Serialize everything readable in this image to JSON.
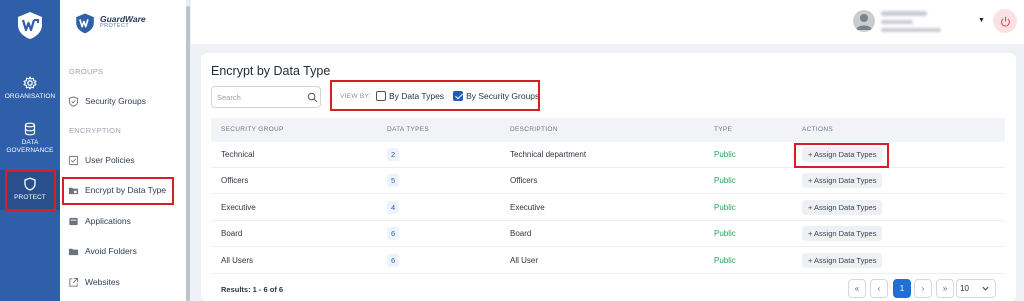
{
  "rail": {
    "items": [
      {
        "label": "ORGANISATION",
        "icon": "gear-icon"
      },
      {
        "label": "DATA\nGOVERNANCE",
        "icon": "database-icon"
      },
      {
        "label": "PROTECT",
        "icon": "shield-icon"
      }
    ]
  },
  "brand": {
    "name": "GuardWare",
    "sub": "PROTECT"
  },
  "sidebar": {
    "sections": [
      {
        "label": "GROUPS",
        "items": [
          {
            "label": "Security Groups",
            "icon": "shield-icon"
          }
        ]
      },
      {
        "label": "ENCRYPTION",
        "items": [
          {
            "label": "User Policies",
            "icon": "checklist-icon"
          },
          {
            "label": "Encrypt by Data Type",
            "icon": "folder-lock-icon"
          },
          {
            "label": "Applications",
            "icon": "app-icon"
          },
          {
            "label": "Avoid Folders",
            "icon": "folder-icon"
          },
          {
            "label": "Websites",
            "icon": "external-link-icon"
          }
        ]
      }
    ]
  },
  "page": {
    "title": "Encrypt by Data Type",
    "search_placeholder": "Search",
    "view_by_label": "VIEW BY:",
    "view_by_options": [
      {
        "label": "By Data Types",
        "checked": false
      },
      {
        "label": "By Security Groups",
        "checked": true
      }
    ]
  },
  "table": {
    "headers": [
      "SECURITY GROUP",
      "DATA TYPES",
      "DESCRIPTION",
      "TYPE",
      "ACTIONS"
    ],
    "rows": [
      {
        "group": "Technical",
        "data_types": "2",
        "description": "Technical department",
        "type": "Public",
        "action": "+ Assign Data Types"
      },
      {
        "group": "Officers",
        "data_types": "5",
        "description": "Officers",
        "type": "Public",
        "action": "+ Assign Data Types"
      },
      {
        "group": "Executive",
        "data_types": "4",
        "description": "Executive",
        "type": "Public",
        "action": "+ Assign Data Types"
      },
      {
        "group": "Board",
        "data_types": "6",
        "description": "Board",
        "type": "Public",
        "action": "+ Assign Data Types"
      },
      {
        "group": "All Users",
        "data_types": "6",
        "description": "All User",
        "type": "Public",
        "action": "+ Assign Data Types"
      }
    ]
  },
  "pagination": {
    "results": "Results: 1 - 6 of 6",
    "first": "«",
    "prev": "‹",
    "current": "1",
    "next": "›",
    "last": "»",
    "page_size": "10"
  },
  "colors": {
    "rail": "#2f5fa8",
    "accent": "#1f6fd6",
    "public": "#28a45a",
    "highlight": "#d41f26"
  }
}
